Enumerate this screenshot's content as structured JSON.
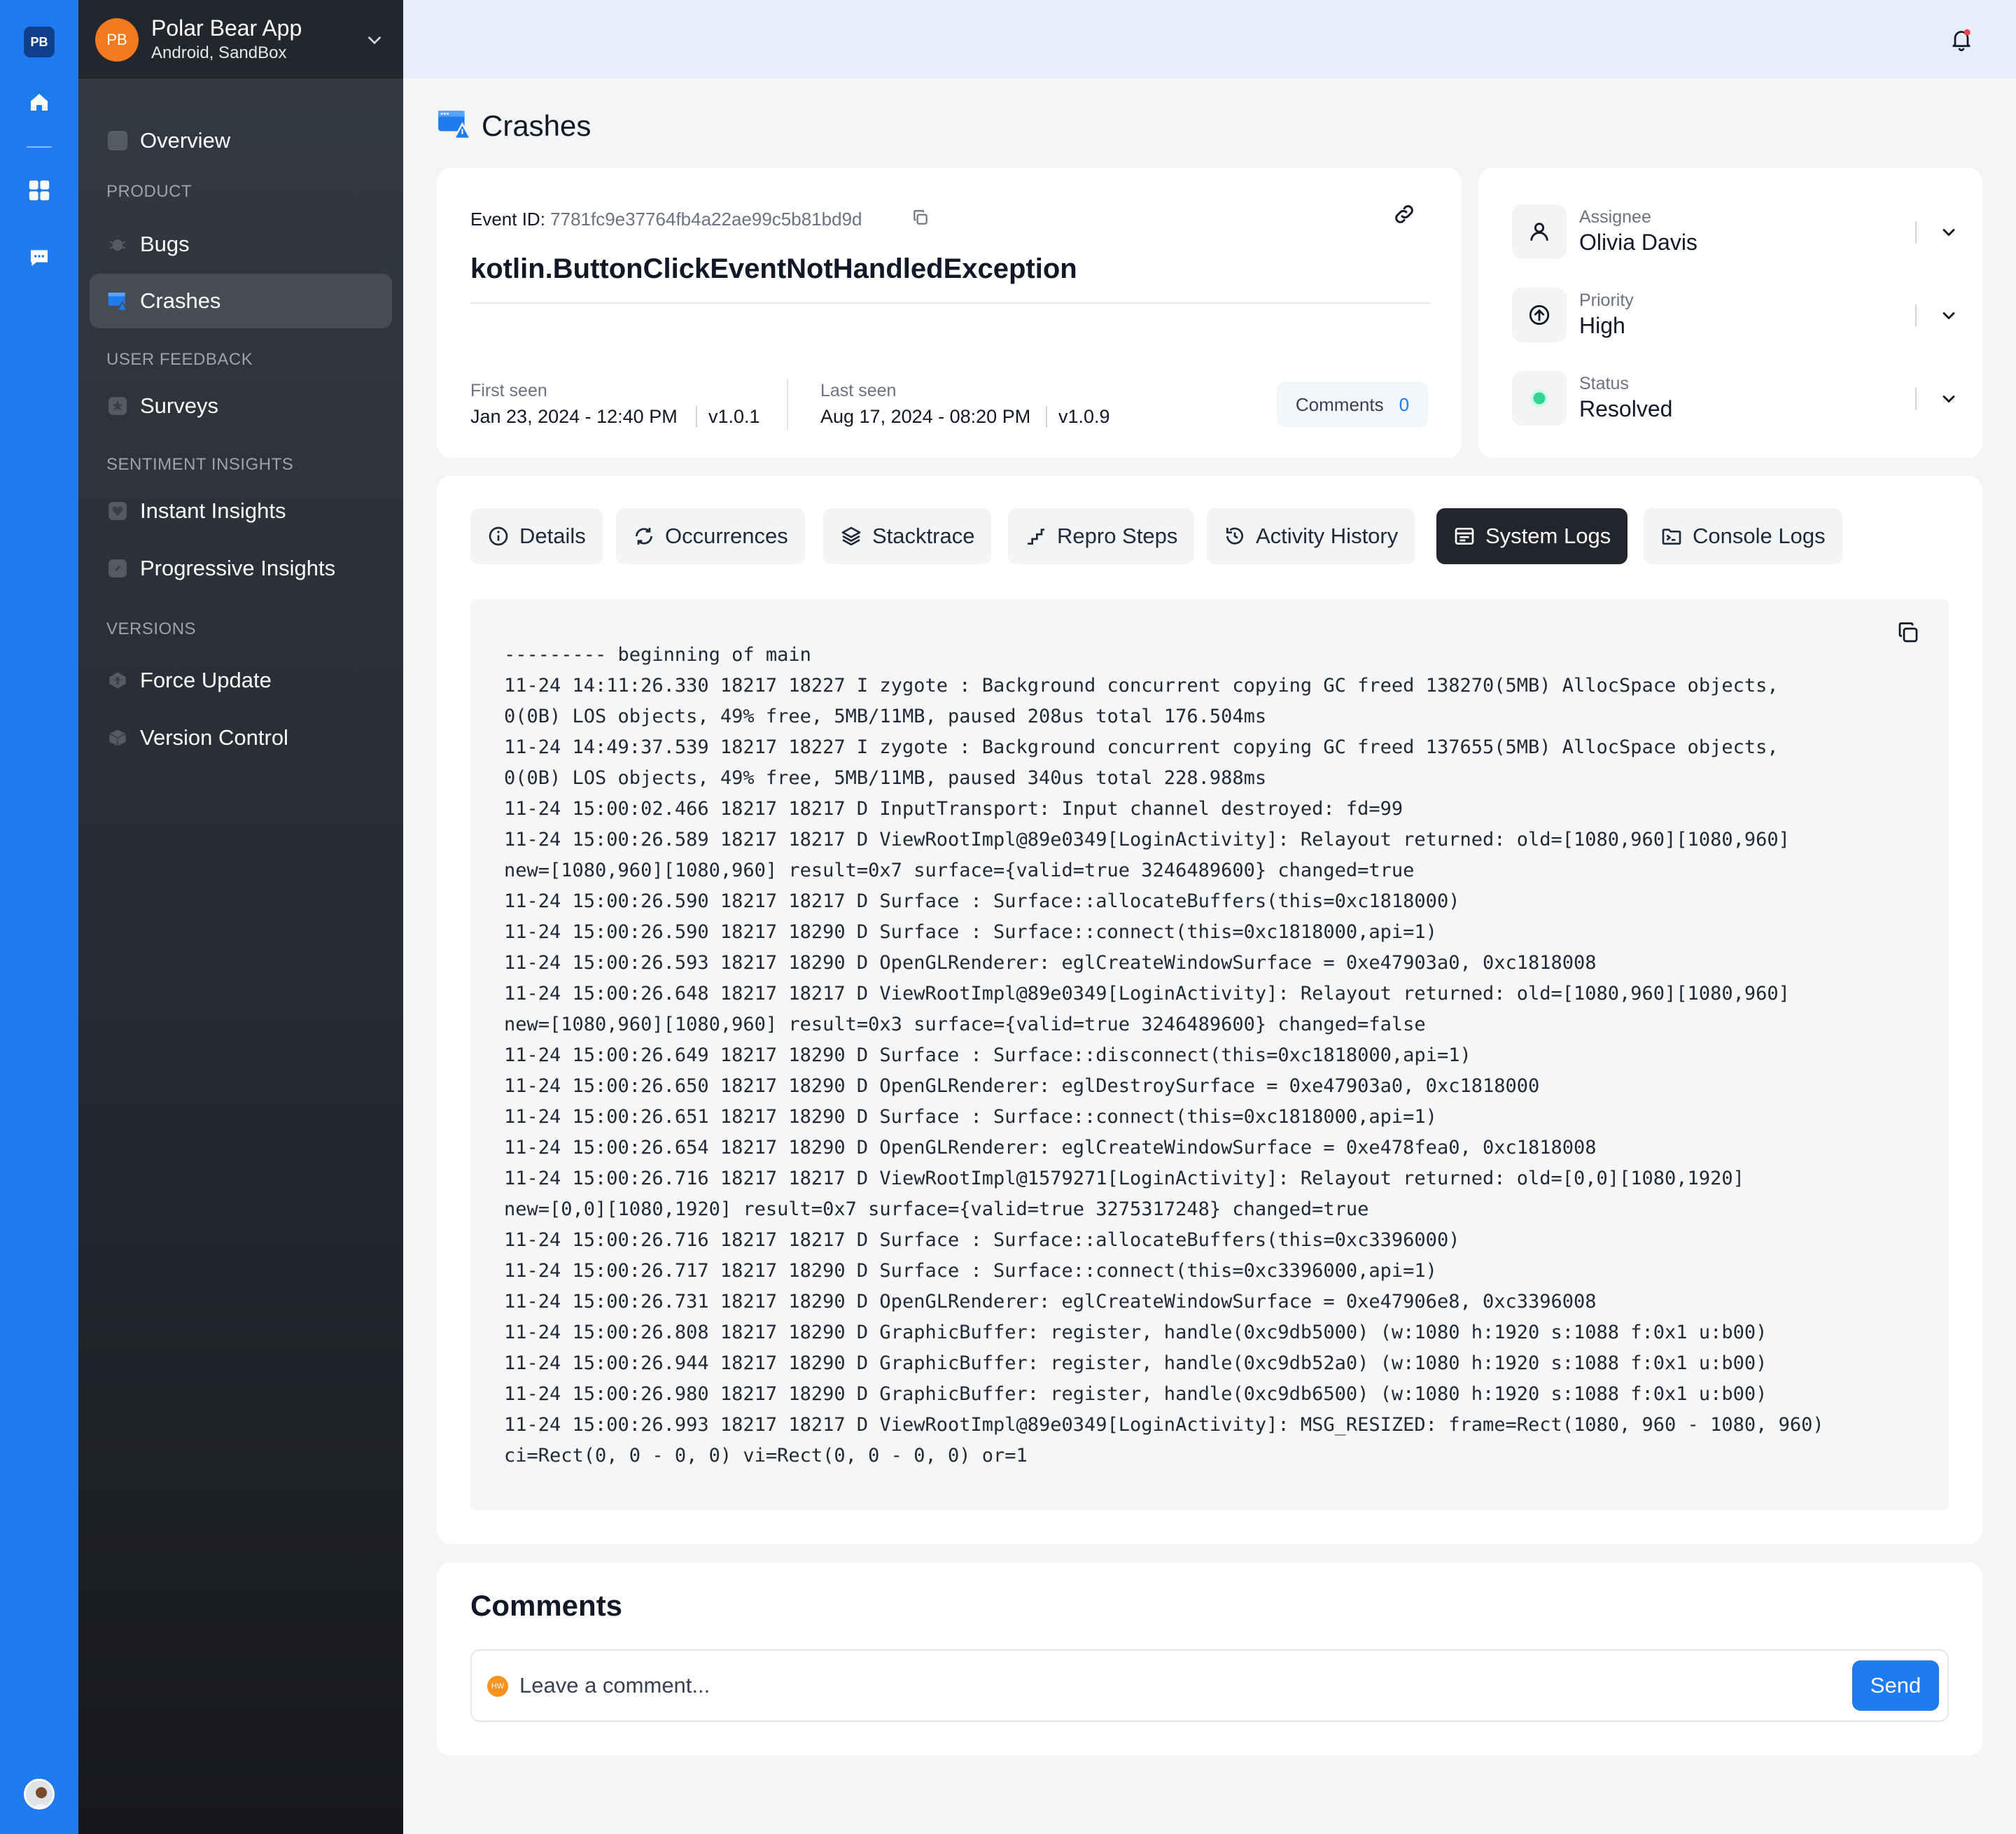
{
  "rail": {
    "logo_text": "PB",
    "icons": [
      "home-icon",
      "grid-icon",
      "chat-icon"
    ]
  },
  "app": {
    "avatar_text": "PB",
    "name": "Polar Bear App",
    "subtitle": "Android, SandBox"
  },
  "nav": {
    "overview": "Overview",
    "sections": {
      "product": "PRODUCT",
      "user_feedback": "USER FEEDBACK",
      "sentiment": "SENTIMENT INSIGHTS",
      "versions": "VERSIONS"
    },
    "bugs": "Bugs",
    "crashes": "Crashes",
    "surveys": "Surveys",
    "instant_insights": "Instant Insights",
    "progressive_insights": "Progressive Insights",
    "force_update": "Force Update",
    "version_control": "Version Control"
  },
  "page": {
    "title": "Crashes"
  },
  "event": {
    "id_label": "Event ID: ",
    "id_value": "7781fc9e37764fb4a22ae99c5b81bd9d",
    "exception": "kotlin.ButtonClickEventNotHandledException",
    "first_seen_label": "First seen",
    "first_seen_value": "Jan 23, 2024 - 12:40 PM",
    "first_seen_version": "v1.0.1",
    "last_seen_label": "Last seen",
    "last_seen_value": "Aug 17, 2024 - 08:20 PM",
    "last_seen_version": "v1.0.9",
    "comments_label": "Comments",
    "comments_count": "0"
  },
  "properties": {
    "assignee_label": "Assignee",
    "assignee_value": "Olivia Davis",
    "priority_label": "Priority",
    "priority_value": "High",
    "status_label": "Status",
    "status_value": "Resolved",
    "status_color": "#34d399"
  },
  "tabs": {
    "details": "Details",
    "occurrences": "Occurrences",
    "stacktrace": "Stacktrace",
    "repro_steps": "Repro Steps",
    "activity_history": "Activity History",
    "system_logs": "System Logs",
    "console_logs": "Console Logs",
    "active": "System Logs"
  },
  "logs": {
    "text": "--------- beginning of main\n11-24 14:11:26.330 18217 18227 I zygote : Background concurrent copying GC freed 138270(5MB) AllocSpace objects,\n0(0B) LOS objects, 49% free, 5MB/11MB, paused 208us total 176.504ms\n11-24 14:49:37.539 18217 18227 I zygote : Background concurrent copying GC freed 137655(5MB) AllocSpace objects,\n0(0B) LOS objects, 49% free, 5MB/11MB, paused 340us total 228.988ms\n11-24 15:00:02.466 18217 18217 D InputTransport: Input channel destroyed: fd=99\n11-24 15:00:26.589 18217 18217 D ViewRootImpl@89e0349[LoginActivity]: Relayout returned: old=[1080,960][1080,960]\nnew=[1080,960][1080,960] result=0x7 surface={valid=true 3246489600} changed=true\n11-24 15:00:26.590 18217 18217 D Surface : Surface::allocateBuffers(this=0xc1818000)\n11-24 15:00:26.590 18217 18290 D Surface : Surface::connect(this=0xc1818000,api=1)\n11-24 15:00:26.593 18217 18290 D OpenGLRenderer: eglCreateWindowSurface = 0xe47903a0, 0xc1818008\n11-24 15:00:26.648 18217 18217 D ViewRootImpl@89e0349[LoginActivity]: Relayout returned: old=[1080,960][1080,960]\nnew=[1080,960][1080,960] result=0x3 surface={valid=true 3246489600} changed=false\n11-24 15:00:26.649 18217 18290 D Surface : Surface::disconnect(this=0xc1818000,api=1)\n11-24 15:00:26.650 18217 18290 D OpenGLRenderer: eglDestroySurface = 0xe47903a0, 0xc1818000\n11-24 15:00:26.651 18217 18290 D Surface : Surface::connect(this=0xc1818000,api=1)\n11-24 15:00:26.654 18217 18290 D OpenGLRenderer: eglCreateWindowSurface = 0xe478fea0, 0xc1818008\n11-24 15:00:26.716 18217 18217 D ViewRootImpl@1579271[LoginActivity]: Relayout returned: old=[0,0][1080,1920]\nnew=[0,0][1080,1920] result=0x7 surface={valid=true 3275317248} changed=true\n11-24 15:00:26.716 18217 18217 D Surface : Surface::allocateBuffers(this=0xc3396000)\n11-24 15:00:26.717 18217 18290 D Surface : Surface::connect(this=0xc3396000,api=1)\n11-24 15:00:26.731 18217 18290 D OpenGLRenderer: eglCreateWindowSurface = 0xe47906e8, 0xc3396008\n11-24 15:00:26.808 18217 18290 D GraphicBuffer: register, handle(0xc9db5000) (w:1080 h:1920 s:1088 f:0x1 u:b00)\n11-24 15:00:26.944 18217 18290 D GraphicBuffer: register, handle(0xc9db52a0) (w:1080 h:1920 s:1088 f:0x1 u:b00)\n11-24 15:00:26.980 18217 18290 D GraphicBuffer: register, handle(0xc9db6500) (w:1080 h:1920 s:1088 f:0x1 u:b00)\n11-24 15:00:26.993 18217 18217 D ViewRootImpl@89e0349[LoginActivity]: MSG_RESIZED: frame=Rect(1080, 960 - 1080, 960)\nci=Rect(0, 0 - 0, 0) vi=Rect(0, 0 - 0, 0) or=1"
  },
  "comments": {
    "title": "Comments",
    "avatar_text": "HW",
    "placeholder": "Leave a comment...",
    "send_label": "Send"
  },
  "colors": {
    "accent": "#1e7bf0",
    "sidebar": "#2b2f36",
    "app_avatar": "#f47a1f",
    "notification_dot": "#ef4444"
  }
}
